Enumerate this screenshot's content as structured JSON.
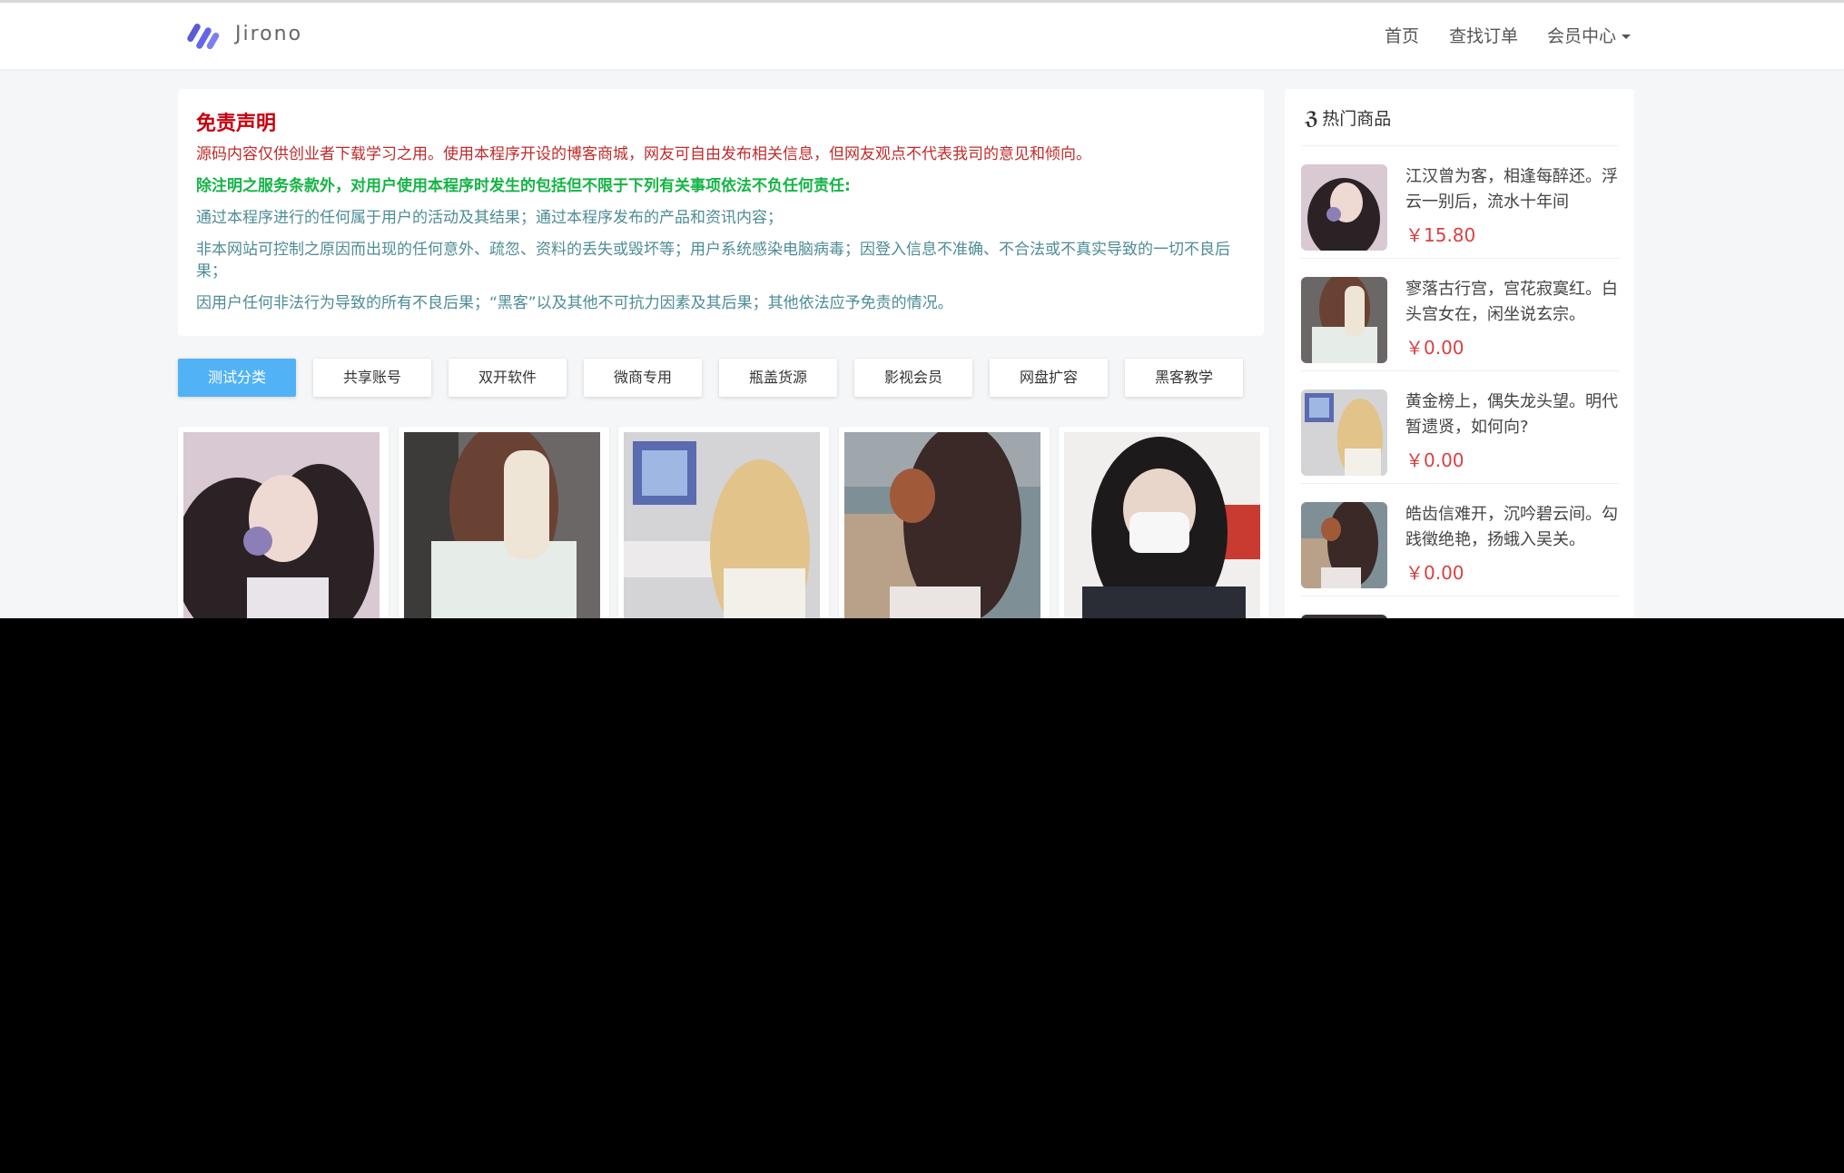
{
  "brand": {
    "name": "Jirono",
    "logo_icon": "logo-slashes-icon",
    "logo_color": "#5b5bd6"
  },
  "nav": {
    "home": "首页",
    "orders": "查找订单",
    "member": "会员中心"
  },
  "notice": {
    "title": "免责声明",
    "line1": "源码内容仅供创业者下载学习之用。使用本程序开设的博客商城，网友可自由发布相关信息，但网友观点不代表我司的意见和倾向。",
    "line2": "除注明之服务条款外，对用户使用本程序时发生的包括但不限于下列有关事项依法不负任何责任:",
    "line3": "通过本程序进行的任何属于用户的活动及其结果；通过本程序发布的产品和资讯内容；",
    "line4": "非本网站可控制之原因而出现的任何意外、疏忽、资料的丢失或毁坏等；用户系统感染电脑病毒；因登入信息不准确、不合法或不真实导致的一切不良后果；",
    "line5": "因用户任何非法行为导致的所有不良后果；“黑客”以及其他不可抗力因素及其后果；其他依法应予免责的情况。"
  },
  "tabs": [
    "测试分类",
    "共享账号",
    "双开软件",
    "微商专用",
    "瓶盖货源",
    "影视会员",
    "网盘扩容",
    "黑客教学"
  ],
  "active_tab": 0,
  "hot": {
    "title": "热门商品",
    "title_icon": "css3-icon",
    "items": [
      {
        "name": "江汉曾为客，相逢每醉还。浮云一别后，流水十年间",
        "price": "￥15.80"
      },
      {
        "name": "寥落古行宫，宫花寂寞红。白头宫女在，闲坐说玄宗。",
        "price": "￥0.00"
      },
      {
        "name": "黄金榜上，偶失龙头望。明代暂遗贤，如何向?",
        "price": "￥0.00"
      },
      {
        "name": "皓齿信难开，沉吟碧云间。勾践徵绝艳，扬蛾入吴关。",
        "price": "￥0.00"
      }
    ]
  },
  "colors": {
    "accent": "#52b2f6",
    "price": "#d94141",
    "notice_title": "#c8000f"
  }
}
